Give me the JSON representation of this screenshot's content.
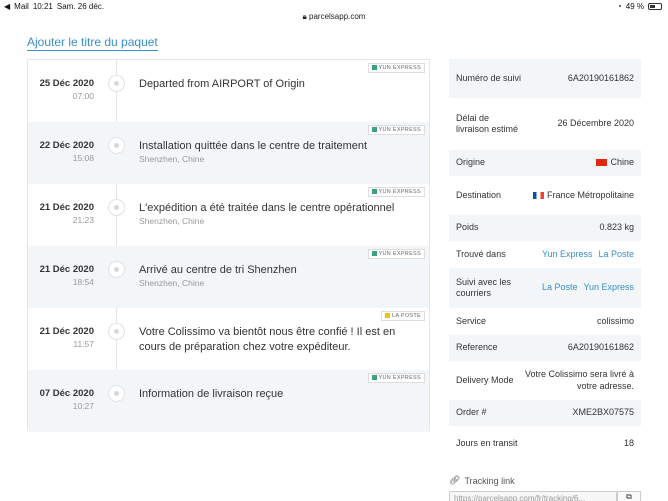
{
  "statusbar": {
    "back_app": "Mail",
    "time": "10:21",
    "date": "Sam. 26 déc.",
    "url": "parcelsapp.com",
    "battery": "49 %",
    "battery_level": 0.49
  },
  "add_title": "Ajouter le titre du paquet",
  "events": [
    {
      "date": "25 Déc 2020",
      "time": "07:00",
      "desc": "Departed from AIRPORT of Origin",
      "loc": "",
      "carrier": "YUN EXPRESS"
    },
    {
      "date": "22 Déc 2020",
      "time": "15:08",
      "desc": "Installation quittée dans le centre de traitement",
      "loc": "Shenzhen, Chine",
      "carrier": "YUN EXPRESS"
    },
    {
      "date": "21 Déc 2020",
      "time": "21:23",
      "desc": "L'expédition a été traitée dans le centre opérationnel",
      "loc": "Shenzhen, Chine",
      "carrier": "YUN EXPRESS"
    },
    {
      "date": "21 Déc 2020",
      "time": "18:54",
      "desc": "Arrivé au centre de tri Shenzhen",
      "loc": "Shenzhen, Chine",
      "carrier": "YUN EXPRESS"
    },
    {
      "date": "21 Déc 2020",
      "time": "11:57",
      "desc": "Votre Colissimo va bientôt nous être confié ! Il est en cours de préparation chez votre expéditeur.",
      "loc": "",
      "carrier": "LA POSTE"
    },
    {
      "date": "07 Déc 2020",
      "time": "10:27",
      "desc": "Information de livraison reçue",
      "loc": "",
      "carrier": "YUN EXPRESS"
    }
  ],
  "details": {
    "numero_key": "Numéro de suivi",
    "numero_val": "6A20190161862",
    "delai_key": "Délai de livraison estimé",
    "delai_val": "26 Décembre 2020",
    "origine_key": "Origine",
    "origine_val": "Chine",
    "dest_key": "Destination",
    "dest_val": "France Métropolitaine",
    "poids_key": "Poids",
    "poids_val": "0.823 kg",
    "trouve_key": "Trouvé dans",
    "trouve_link1": "Yun Express",
    "trouve_link2": "La Poste",
    "suivi_key": "Suivi avec les courriers",
    "suivi_link1": "La Poste",
    "suivi_link2": "Yun Express",
    "service_key": "Service",
    "service_val": "colissimo",
    "ref_key": "Reference",
    "ref_val": "6A20190161862",
    "mode_key": "Delivery Mode",
    "mode_val": "Votre Colissimo sera livré à votre adresse.",
    "order_key": "Order #",
    "order_val": "XME2BX07575",
    "jours_key": "Jours en transit",
    "jours_val": "18"
  },
  "tracking": {
    "label": "Tracking link",
    "value": "https://parcelsapp.com/fr/tracking/6..."
  }
}
